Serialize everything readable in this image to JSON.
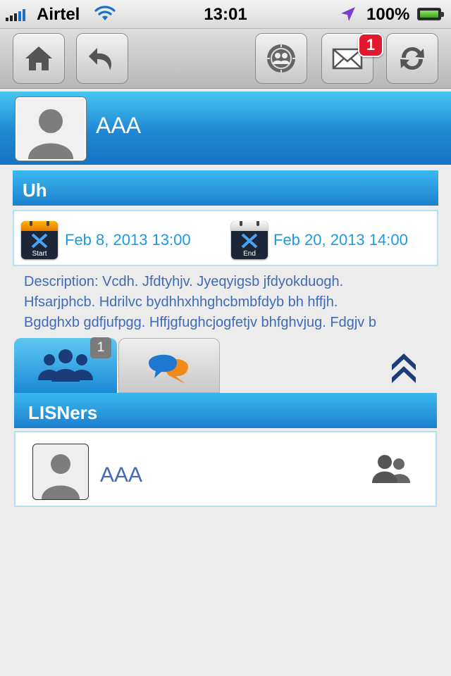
{
  "status_bar": {
    "carrier": "Airtel",
    "time": "13:01",
    "battery": "100%"
  },
  "toolbar": {
    "mail_badge": "1",
    "icons": [
      "home-icon",
      "back-icon",
      "group-target-icon",
      "mail-icon",
      "refresh-icon"
    ]
  },
  "profile": {
    "name": "AAA"
  },
  "event": {
    "title": "Uh",
    "start_label": "Start",
    "start_date": "Feb 8, 2013  13:00",
    "end_label": "End",
    "end_date": "Feb 20, 2013  14:00",
    "description_lines": [
      "Description: Vcdh. Jfdtyhjv. Jyeqyigsb jfdyokduogh.",
      "Hfsarjphcb. Hdrilvc bydhhxhhghcbmbfdyb bh hffjh.",
      "Bgdghxb gdfjufpgg. Hffjgfughcjogfetjv bhfghvjug. Fdgjv b"
    ]
  },
  "tabs": {
    "listeners_count": "1",
    "icons": [
      "people-icon",
      "chat-icon",
      "collapse-up-icon"
    ]
  },
  "listeners": {
    "header": "LISNers",
    "items": [
      {
        "name": "AAA"
      }
    ]
  },
  "colors": {
    "accent_blue": "#1d9be0",
    "header_blue": "#1c80cf",
    "text_blue": "#3f6ab5",
    "badge_red": "#e2182e"
  }
}
